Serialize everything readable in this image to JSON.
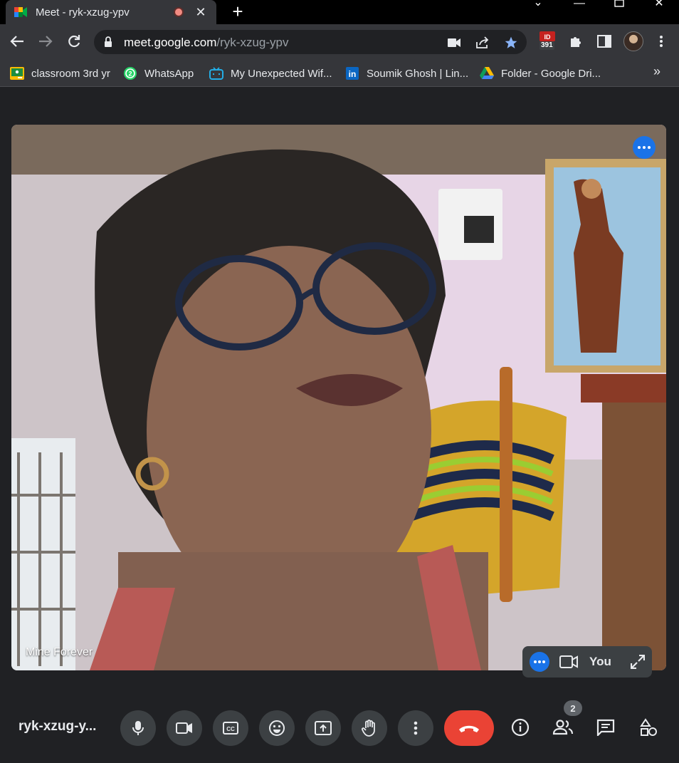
{
  "browser": {
    "tab_title": "Meet - ryk-xzug-ypv",
    "url_host": "meet.google.com",
    "url_path": "/ryk-xzug-ypv",
    "extension_badge": "391",
    "bookmarks": [
      {
        "label": "classroom 3rd yr",
        "icon": "google-classroom-icon"
      },
      {
        "label": "WhatsApp",
        "icon": "whatsapp-icon"
      },
      {
        "label": "My Unexpected Wif...",
        "icon": "bilibili-icon"
      },
      {
        "label": "Soumik Ghosh | Lin...",
        "icon": "linkedin-icon"
      },
      {
        "label": "Folder - Google Dri...",
        "icon": "google-drive-icon"
      }
    ],
    "bookmarks_overflow": "»"
  },
  "meet": {
    "participant_name": "Mine Forever",
    "self_label": "You",
    "meeting_code": "ryk-xzug-y...",
    "people_count": "2"
  },
  "colors": {
    "stage_bg": "#202124",
    "end_call": "#ea4335",
    "accent_blue": "#1a73e8",
    "button_bg": "#3c4043"
  }
}
